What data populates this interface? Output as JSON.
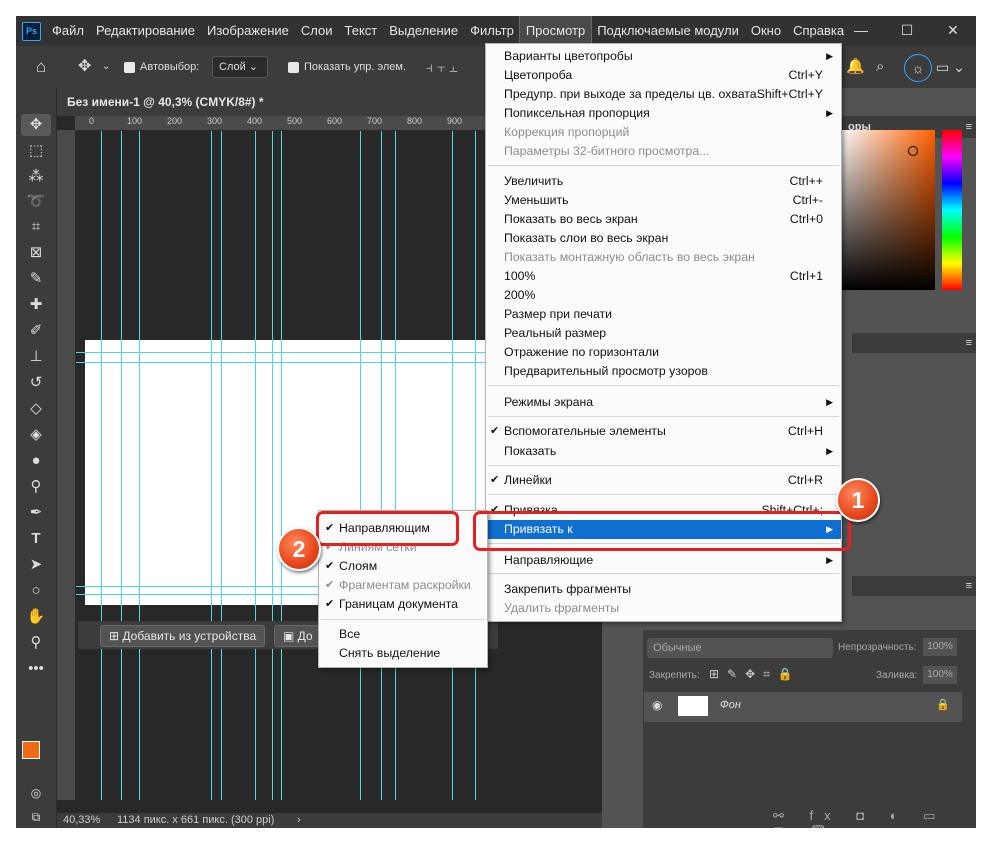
{
  "menubar": {
    "app_icon": "Ps",
    "items": [
      "Файл",
      "Редактирование",
      "Изображение",
      "Слои",
      "Текст",
      "Выделение",
      "Фильтр",
      "Просмотр",
      "Подключаемые модули",
      "Окно",
      "Справка"
    ]
  },
  "window_controls": {
    "minimize": "—",
    "maximize": "☐",
    "close": "✕"
  },
  "options": {
    "autoselect_label": "Автовыбор:",
    "autoselect_value": "Слой",
    "show_controls_label": "Показать упр. элем."
  },
  "document": {
    "tab_title": "Без имени-1 @ 40,3% (CMYK/8#) *",
    "ruler_ticks": [
      "0",
      "100",
      "200",
      "300",
      "400",
      "500",
      "600",
      "700",
      "800",
      "900"
    ],
    "zoom": "40,33%",
    "size_info": "1134 пикс. x 661 пикс. (300 ppi)"
  },
  "canvas_buttons": {
    "add_from_device": "Добавить из устройства",
    "partial": "До"
  },
  "view_menu": {
    "items": [
      {
        "label": "Варианты цветопробы",
        "arrow": true
      },
      {
        "label": "Цветопроба",
        "shortcut": "Ctrl+Y"
      },
      {
        "label": "Предупр. при выходе за пределы цв. охвата",
        "shortcut": "Shift+Ctrl+Y"
      },
      {
        "label": "Попиксельная пропорция",
        "arrow": true
      },
      {
        "label": "Коррекция пропорций",
        "disabled": true
      },
      {
        "label": "Параметры 32-битного просмотра...",
        "disabled": true
      },
      {
        "label": "Увеличить",
        "shortcut": "Ctrl++"
      },
      {
        "label": "Уменьшить",
        "shortcut": "Ctrl+-"
      },
      {
        "label": "Показать во весь экран",
        "shortcut": "Ctrl+0"
      },
      {
        "label": "Показать слои во весь экран"
      },
      {
        "label": "Показать монтажную область во весь экран",
        "disabled": true
      },
      {
        "label": "100%",
        "shortcut": "Ctrl+1"
      },
      {
        "label": "200%"
      },
      {
        "label": "Размер при печати"
      },
      {
        "label": "Реальный размер"
      },
      {
        "label": "Отражение по горизонтали"
      },
      {
        "label": "Предварительный просмотр узоров"
      },
      {
        "label": "Режимы экрана",
        "arrow": true
      },
      {
        "label": "Вспомогательные элементы",
        "shortcut": "Ctrl+H",
        "checked": true
      },
      {
        "label": "Показать",
        "arrow": true
      },
      {
        "label": "Линейки",
        "shortcut": "Ctrl+R",
        "checked": true
      },
      {
        "label": "Привязка",
        "shortcut": "Shift+Ctrl+;",
        "checked": true
      },
      {
        "label": "Привязать к",
        "arrow": true,
        "highlighted": true
      },
      {
        "label": "Направляющие",
        "arrow": true
      },
      {
        "label": "Закрепить фрагменты"
      },
      {
        "label": "Удалить фрагменты",
        "disabled": true
      }
    ]
  },
  "snap_submenu": {
    "items": [
      {
        "label": "Направляющим",
        "checked": true
      },
      {
        "label": "Линиям сетки",
        "checked": true,
        "disabled": true
      },
      {
        "label": "Слоям",
        "checked": true
      },
      {
        "label": "Фрагментам раскройки",
        "checked": true,
        "disabled": true
      },
      {
        "label": "Границам документа",
        "checked": true
      },
      {
        "label": "Все"
      },
      {
        "label": "Снять выделение"
      }
    ]
  },
  "right_panel": {
    "colors_tab": "оры",
    "blend_mode": "Обычные",
    "opacity_label": "Непрозрачность:",
    "opacity_value": "100%",
    "lock_label": "Закрепить:",
    "fill_label": "Заливка:",
    "fill_value": "100%",
    "layer_name": "Фон"
  },
  "annotations": {
    "badge1": "1",
    "badge2": "2",
    "accent": "#e32121"
  }
}
